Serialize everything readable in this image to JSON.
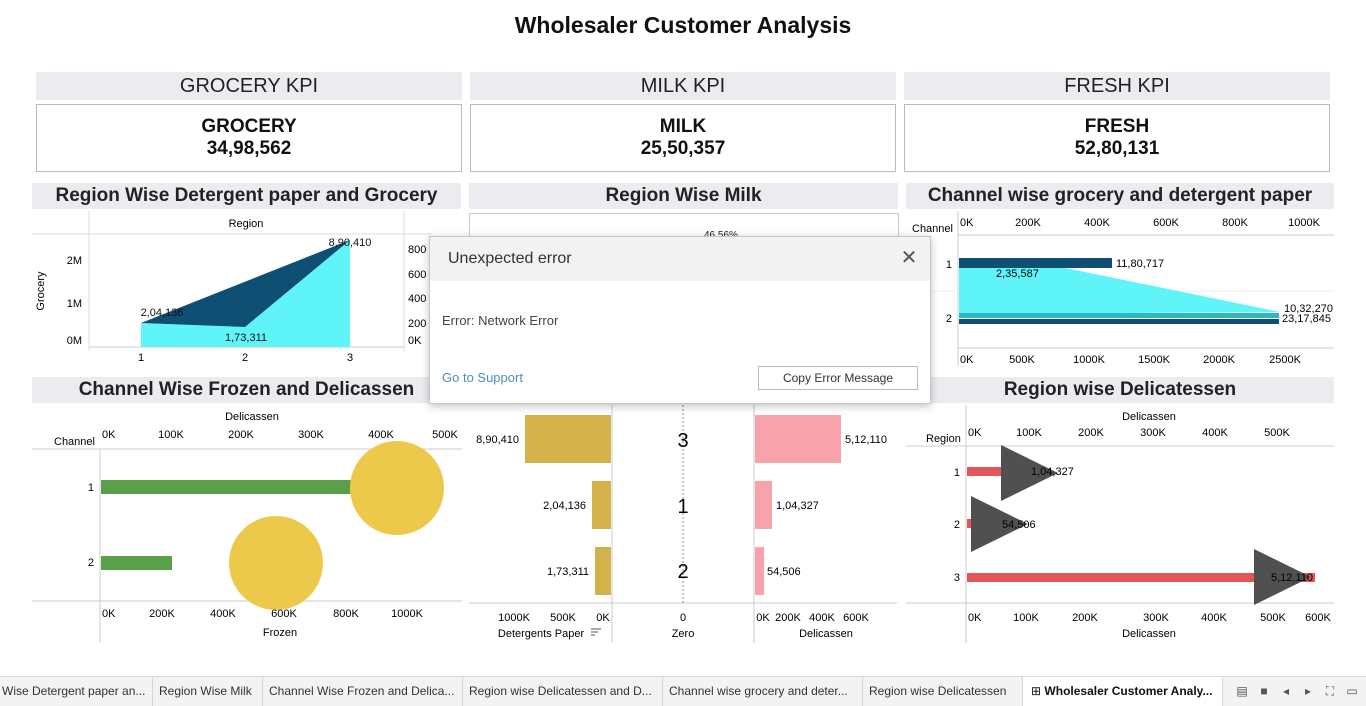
{
  "title": "Wholesaler Customer Analysis",
  "kpis": [
    {
      "header": "GROCERY KPI",
      "label": "GROCERY",
      "value": "34,98,562"
    },
    {
      "header": "MILK KPI",
      "label": "MILK",
      "value": "25,50,357"
    },
    {
      "header": "FRESH KPI",
      "label": "FRESH",
      "value": "52,80,131"
    }
  ],
  "panels": {
    "region_detergent_grocery": {
      "title": "Region Wise Detergent paper and Grocery",
      "top_label": "Region",
      "y_label": "Grocery",
      "y_ticks": [
        "2M",
        "1M",
        "0M"
      ],
      "y2_ticks": [
        "800",
        "600",
        "400",
        "200",
        "0K"
      ],
      "x_ticks": [
        "1",
        "2",
        "3"
      ],
      "data_labels": [
        "8,90,410",
        "2,04,136",
        "1,73,311"
      ]
    },
    "region_milk": {
      "title": "Region Wise Milk",
      "partial_label": "46.56%"
    },
    "channel_grocery_detergent": {
      "title": "Channel wise grocery and detergent paper",
      "channel_label": "Channel",
      "top_ticks": [
        "0K",
        "200K",
        "400K",
        "600K",
        "800K",
        "1000K"
      ],
      "bottom_ticks": [
        "0K",
        "500K",
        "1000K",
        "1500K",
        "2000K",
        "2500K"
      ],
      "rows": [
        "1",
        "2"
      ],
      "data_labels": [
        "11,80,717",
        "2,35,587",
        "10,32,270",
        "23,17,845"
      ]
    },
    "channel_frozen_delicassen": {
      "title": "Channel Wise Frozen and Delicassen",
      "top_label": "Delicassen",
      "channel_label": "Channel",
      "top_ticks": [
        "0K",
        "100K",
        "200K",
        "300K",
        "400K",
        "500K"
      ],
      "bottom_ticks": [
        "0K",
        "200K",
        "400K",
        "600K",
        "800K",
        "1000K"
      ],
      "bottom_label": "Frozen",
      "rows": [
        "1",
        "2"
      ]
    },
    "region_detergent_delicassen": {
      "left_labels": [
        "8,90,410",
        "2,04,136",
        "1,73,311"
      ],
      "center_labels": [
        "3",
        "1",
        "2"
      ],
      "right_labels": [
        "5,12,110",
        "1,04,327",
        "54,506"
      ],
      "left_ticks": [
        "1000K",
        "500K",
        "0K"
      ],
      "center_tick": "0",
      "right_ticks": [
        "0K",
        "200K",
        "400K",
        "600K"
      ],
      "left_axis_label": "Detergents Paper",
      "center_axis_label": "Zero",
      "right_axis_label": "Delicassen"
    },
    "region_delicatessen": {
      "title": "Region wise Delicatessen",
      "top_label": "Delicassen",
      "region_label": "Region",
      "top_ticks": [
        "0K",
        "100K",
        "200K",
        "300K",
        "400K",
        "500K"
      ],
      "bottom_ticks": [
        "0K",
        "100K",
        "200K",
        "300K",
        "400K",
        "500K",
        "600K"
      ],
      "bottom_label": "Delicassen",
      "rows": [
        "1",
        "2",
        "3"
      ],
      "data_labels": [
        "1,04,327",
        "54,506",
        "5,12,110"
      ]
    }
  },
  "chart_data": [
    {
      "type": "area",
      "title": "Region Wise Detergent paper and Grocery",
      "categories": [
        "1",
        "2",
        "3"
      ],
      "series": [
        {
          "values": [
            204136,
            173311,
            890410
          ]
        }
      ],
      "ylabel": "Grocery",
      "xlabel": "Region"
    },
    {
      "type": "bar",
      "title": "Channel wise grocery and detergent paper",
      "categories": [
        "1",
        "2"
      ],
      "series": [
        {
          "values": [
            1180717,
            2317845
          ]
        },
        {
          "values": [
            235587,
            1032270
          ]
        }
      ]
    },
    {
      "type": "bar",
      "title": "Region wise Delicatessen",
      "categories": [
        "1",
        "2",
        "3"
      ],
      "values": [
        104327,
        54506,
        512110
      ],
      "xlabel": "Delicassen",
      "ylabel": "Region"
    },
    {
      "type": "bar",
      "categories": [
        "3",
        "1",
        "2"
      ],
      "series": [
        {
          "name": "Detergents Paper",
          "values": [
            890410,
            204136,
            173311
          ]
        },
        {
          "name": "Delicassen",
          "values": [
            512110,
            104327,
            54506
          ]
        }
      ]
    }
  ],
  "modal": {
    "title": "Unexpected error",
    "message": "Error: Network Error",
    "support_link": "Go to Support",
    "copy_button": "Copy Error Message"
  },
  "tabs": [
    "Wise Detergent paper an...",
    "Region Wise Milk",
    "Channel Wise Frozen and Delica...",
    "Region wise Delicatessen and D...",
    "Channel wise grocery and deter...",
    "Region wise Delicatessen",
    "Wholesaler Customer Analy..."
  ],
  "colors": {
    "dark_blue": "#0e4f73",
    "cyan": "#5ff5f8",
    "gold": "#d4b24a",
    "pink": "#f8a2ac",
    "green": "#5aa04a",
    "yellow": "#ecc94b",
    "red": "#e15759",
    "gray_triangle": "#505050"
  }
}
